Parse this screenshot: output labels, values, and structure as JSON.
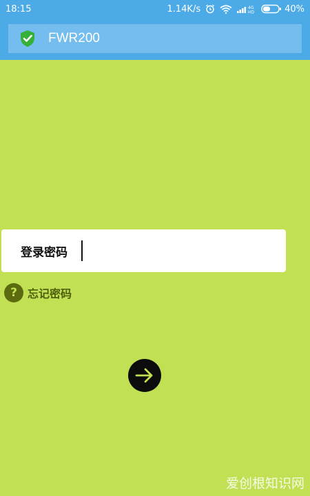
{
  "status_bar": {
    "time": "18:15",
    "net_speed": "1.14K/s",
    "battery": "40%",
    "icons": [
      "alarm-icon",
      "wifi-icon",
      "signal-icon",
      "battery-icon"
    ]
  },
  "header": {
    "title": "FWR200",
    "icon": "shield-check-icon"
  },
  "login": {
    "password_label": "登录密码",
    "password_value": "",
    "forgot_label": "忘记密码"
  },
  "watermark": "爱创根知识网",
  "colors": {
    "background": "#c1e053",
    "header": "#4cabe6",
    "title_bar": "#74bdee",
    "shield_green": "#35b13a",
    "button": "#0c0c0c"
  }
}
